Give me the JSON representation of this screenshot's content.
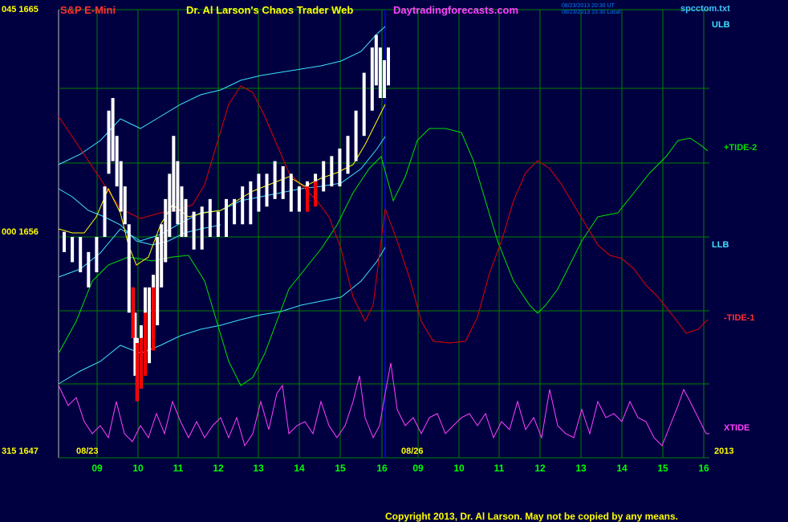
{
  "header": {
    "symbol": "S&P E-Mini",
    "title": "Dr. Al Larson's Chaos Trader Web",
    "site": "Daytradingforecasts.com",
    "time_ut": "08/23/2013 20:30 UT",
    "time_local": "08/23/2013 15:30 Local",
    "file": "spcctom.txt"
  },
  "y_labels": [
    {
      "index": "045",
      "price": "1665"
    },
    {
      "index": "000",
      "price": "1656"
    },
    {
      "index": "315",
      "price": "1647"
    }
  ],
  "date_labels": {
    "left": "08/23",
    "mid": "08/26",
    "year": "2013"
  },
  "right_labels": {
    "ulb": "ULB",
    "tide2": "+TIDE-2",
    "llb": "LLB",
    "tide1": "-TIDE-1",
    "xtide": "XTIDE"
  },
  "copyright": "Copyright 2013, Dr. Al Larson. May not be copied by any means.",
  "colors": {
    "background": "#000040",
    "grid": "#008000",
    "band": "#40e0ff",
    "tide_plus": "#00e000",
    "tide_minus": "#e00000",
    "xtide": "#ff40ff",
    "price_up": "#ffffff",
    "price_down": "#ff0000",
    "average": "#ffff00",
    "now_line": "#0000ff"
  },
  "chart_data": {
    "type": "line",
    "title": "S&P E-Mini",
    "x_tick_labels": [
      "09",
      "10",
      "11",
      "12",
      "13",
      "14",
      "15",
      "16",
      "09",
      "10",
      "11",
      "12",
      "13",
      "14",
      "15",
      "16"
    ],
    "x_unit": "hour",
    "y_range_price": [
      1647,
      1665
    ],
    "price_bars": [
      [
        0,
        1655.4,
        1656.2
      ],
      [
        0.2,
        1655.0,
        1656.0
      ],
      [
        0.4,
        1654.6,
        1656.0
      ],
      [
        0.6,
        1654.0,
        1655.4
      ],
      [
        0.8,
        1654.6,
        1656.0
      ],
      [
        1.0,
        1656.0,
        1658.0
      ],
      [
        1.1,
        1658.5,
        1661.0
      ],
      [
        1.2,
        1659.0,
        1661.5
      ],
      [
        1.3,
        1658.0,
        1660.0
      ],
      [
        1.4,
        1657.0,
        1659.0
      ],
      [
        1.5,
        1656.5,
        1658.0
      ],
      [
        1.6,
        1653.0,
        1656.5
      ],
      [
        1.7,
        1652.0,
        1654.0
      ],
      [
        1.75,
        1650.5,
        1653.0
      ],
      [
        1.8,
        1649.5,
        1652.0
      ],
      [
        1.9,
        1650.0,
        1652.5
      ],
      [
        2.0,
        1651.5,
        1654.0
      ],
      [
        2.1,
        1651.0,
        1654.0
      ],
      [
        2.2,
        1652.0,
        1654.5
      ],
      [
        2.3,
        1652.5,
        1656.0
      ],
      [
        2.4,
        1654.0,
        1656.5
      ],
      [
        2.5,
        1655.0,
        1657.5
      ],
      [
        2.6,
        1656.0,
        1658.5
      ],
      [
        2.7,
        1657.0,
        1660.0
      ],
      [
        2.8,
        1656.5,
        1659.0
      ],
      [
        2.9,
        1656.0,
        1658.0
      ],
      [
        3.0,
        1656.0,
        1657.5
      ],
      [
        3.2,
        1655.5,
        1657.0
      ],
      [
        3.4,
        1655.5,
        1657.2
      ],
      [
        3.6,
        1656.0,
        1657.5
      ],
      [
        3.8,
        1656.0,
        1657.0
      ],
      [
        4.0,
        1656.0,
        1657.5
      ],
      [
        4.2,
        1656.5,
        1657.5
      ],
      [
        4.4,
        1656.5,
        1658.0
      ],
      [
        4.6,
        1656.5,
        1658.2
      ],
      [
        4.8,
        1657.0,
        1658.5
      ],
      [
        5.0,
        1657.2,
        1658.5
      ],
      [
        5.2,
        1657.5,
        1659.0
      ],
      [
        5.4,
        1657.5,
        1658.8
      ],
      [
        5.6,
        1657.0,
        1658.5
      ],
      [
        5.8,
        1657.0,
        1658.0
      ],
      [
        6.0,
        1657.0,
        1658.2
      ],
      [
        6.2,
        1657.5,
        1658.5
      ],
      [
        6.4,
        1657.8,
        1659.0
      ],
      [
        6.6,
        1658.0,
        1659.2
      ],
      [
        6.8,
        1658.0,
        1659.5
      ],
      [
        7.0,
        1658.5,
        1660.0
      ],
      [
        7.2,
        1659.0,
        1661.0
      ],
      [
        7.4,
        1660.0,
        1662.5
      ],
      [
        7.6,
        1661.0,
        1663.5
      ],
      [
        7.7,
        1662.0,
        1664.0
      ],
      [
        7.8,
        1661.5,
        1663.5
      ],
      [
        7.9,
        1661.5,
        1663.0
      ],
      [
        8.0,
        1662.0,
        1663.5
      ]
    ],
    "red_bars": [
      [
        1.7,
        1652.0,
        1654.0
      ],
      [
        1.8,
        1649.5,
        1651.8
      ],
      [
        1.9,
        1650.0,
        1652.0
      ],
      [
        2.0,
        1650.5,
        1653.0
      ],
      [
        2.2,
        1651.5,
        1654.0
      ],
      [
        6.0,
        1657.0,
        1658.0
      ],
      [
        6.2,
        1657.2,
        1658.2
      ]
    ]
  }
}
